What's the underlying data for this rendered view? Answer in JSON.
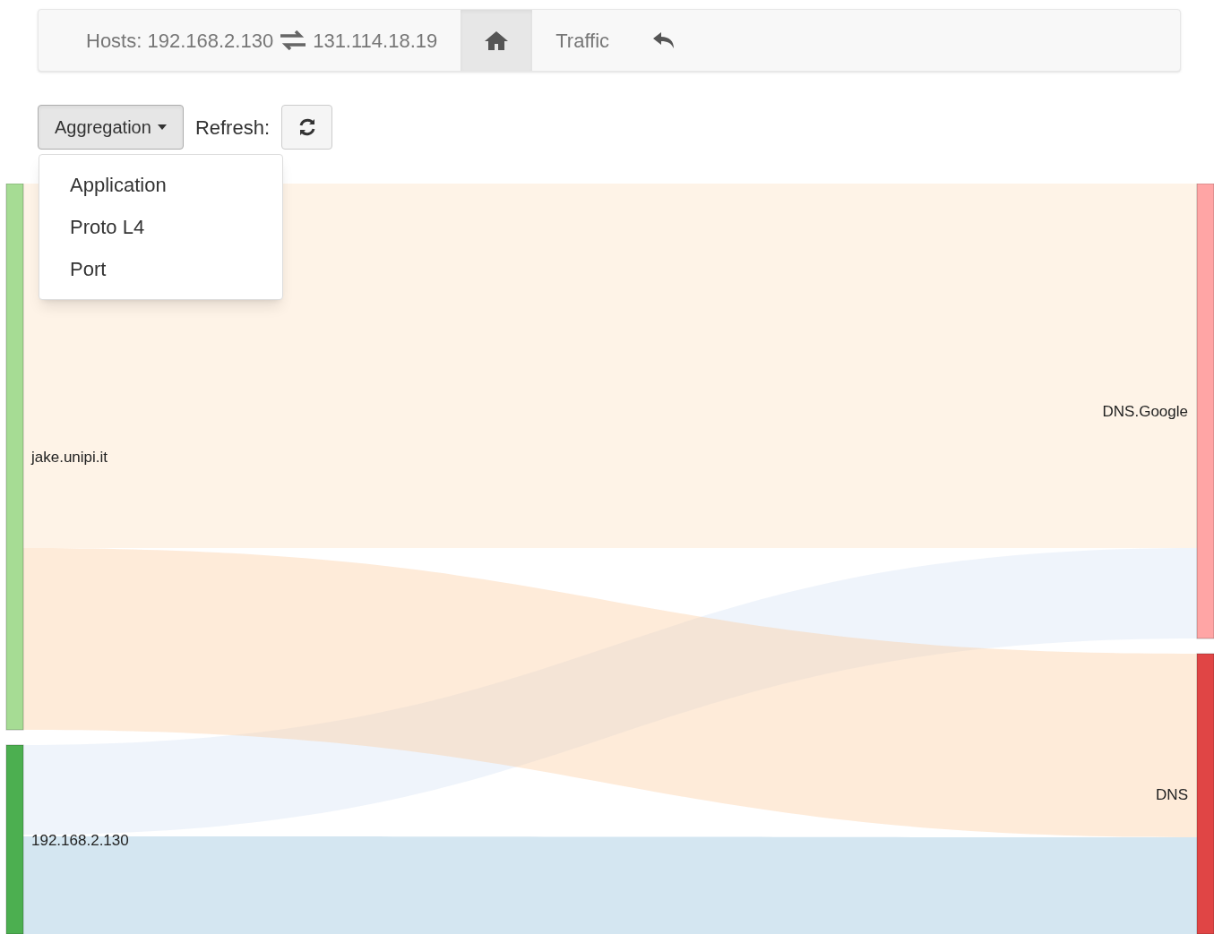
{
  "navbar": {
    "hosts_label": "Hosts: 192.168.2.130",
    "peer": "131.114.18.19",
    "tabs": [
      {
        "kind": "home",
        "selected": true
      },
      {
        "kind": "text",
        "label": "Traffic",
        "selected": false
      },
      {
        "kind": "back",
        "selected": false
      }
    ]
  },
  "toolbar": {
    "aggregation": "Aggregation",
    "refresh_label": "Refresh:",
    "menu": {
      "expanded": true,
      "items": [
        "Application",
        "Proto L4",
        "Port"
      ]
    }
  },
  "sankey": {
    "left_nodes": [
      {
        "label": "jake.unipi.it",
        "color": "#a6dc94"
      },
      {
        "label": "192.168.2.130",
        "color": "#4caf50"
      }
    ],
    "right_nodes": [
      {
        "label": "DNS.Google",
        "color": "#ffa5a5"
      },
      {
        "label": "DNS",
        "color": "#e04545"
      }
    ]
  }
}
